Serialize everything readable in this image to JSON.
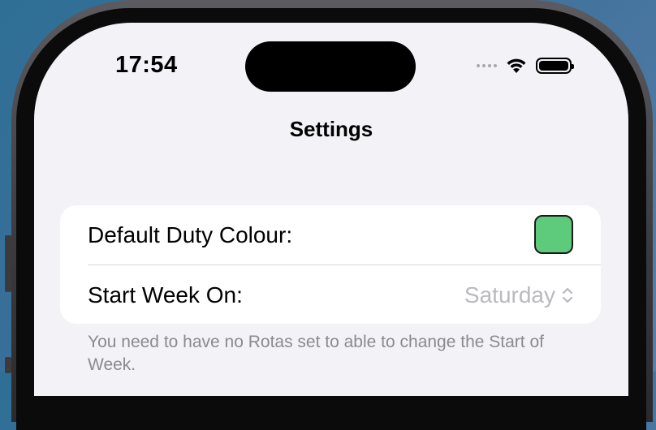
{
  "status_bar": {
    "time": "17:54"
  },
  "nav": {
    "title": "Settings"
  },
  "settings": {
    "rows": [
      {
        "label": "Default Duty Colour:",
        "color_value": "#5ecb7c"
      },
      {
        "label": "Start Week On:",
        "selected_value": "Saturday"
      }
    ],
    "footer_note": "You need to have no Rotas set to able to change the Start of Week."
  },
  "icons": {
    "signal": "cellular-signal-icon",
    "wifi": "wifi-icon",
    "battery": "battery-icon",
    "chevron": "up-down-chevron-icon"
  },
  "colors": {
    "screen_background": "#f2f2f7",
    "card_background": "#ffffff",
    "swatch_green": "#5ecb7c",
    "secondary_text": "#8a8a8f"
  }
}
